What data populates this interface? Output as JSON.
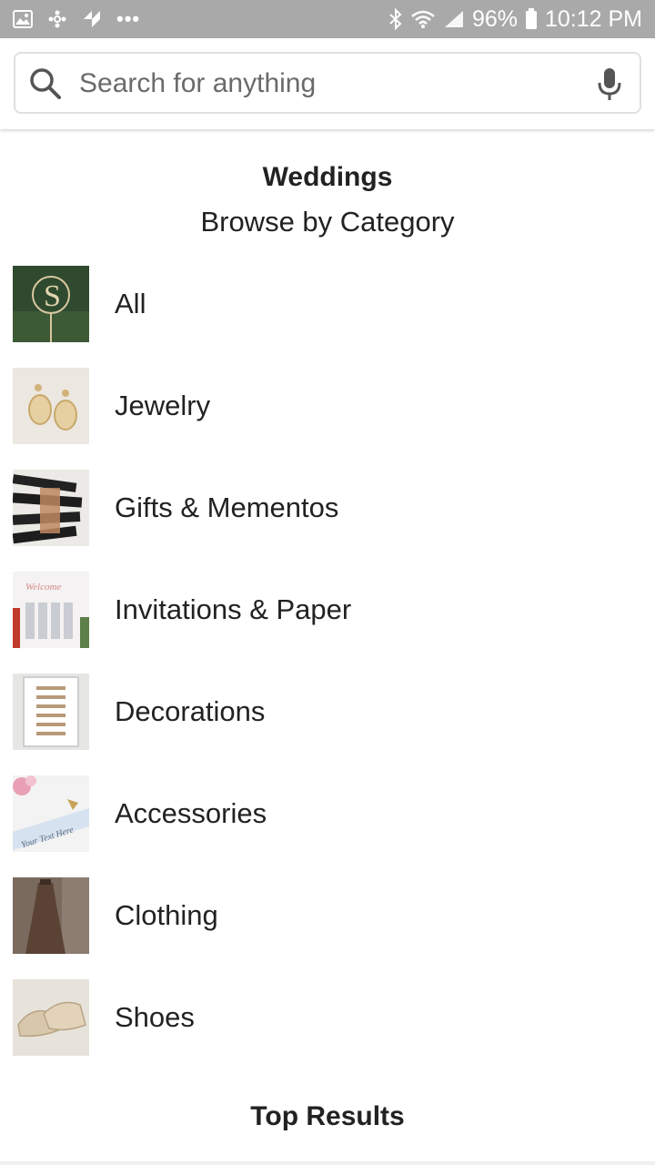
{
  "status_bar": {
    "battery": "96%",
    "time": "10:12 PM",
    "left_icons": [
      "image-icon",
      "pinwheel-icon",
      "shuffle-icon",
      "more-dots-icon"
    ],
    "right_icons": [
      "bluetooth-icon",
      "wifi-icon",
      "signal-icon",
      "battery-icon"
    ],
    "more_dots": "•••"
  },
  "search": {
    "placeholder": "Search for anything"
  },
  "heading": {
    "title": "Weddings",
    "subtitle": "Browse by Category"
  },
  "categories": [
    {
      "label": "All",
      "thumb_color": "#2f4a2e"
    },
    {
      "label": "Jewelry",
      "thumb_color": "#e9e3da"
    },
    {
      "label": "Gifts & Mementos",
      "thumb_color": "#8a5a3c"
    },
    {
      "label": "Invitations & Paper",
      "thumb_color": "#eef0f3"
    },
    {
      "label": "Decorations",
      "thumb_color": "#e8e8e6"
    },
    {
      "label": "Accessories",
      "thumb_color": "#e7eef5"
    },
    {
      "label": "Clothing",
      "thumb_color": "#6f5a4c"
    },
    {
      "label": "Shoes",
      "thumb_color": "#d9cfc2"
    }
  ],
  "top_results": {
    "title": "Top Results"
  },
  "colors": {
    "status_bar": "#a9a9a9",
    "text": "#222222",
    "search_border": "#e0e0e0"
  }
}
